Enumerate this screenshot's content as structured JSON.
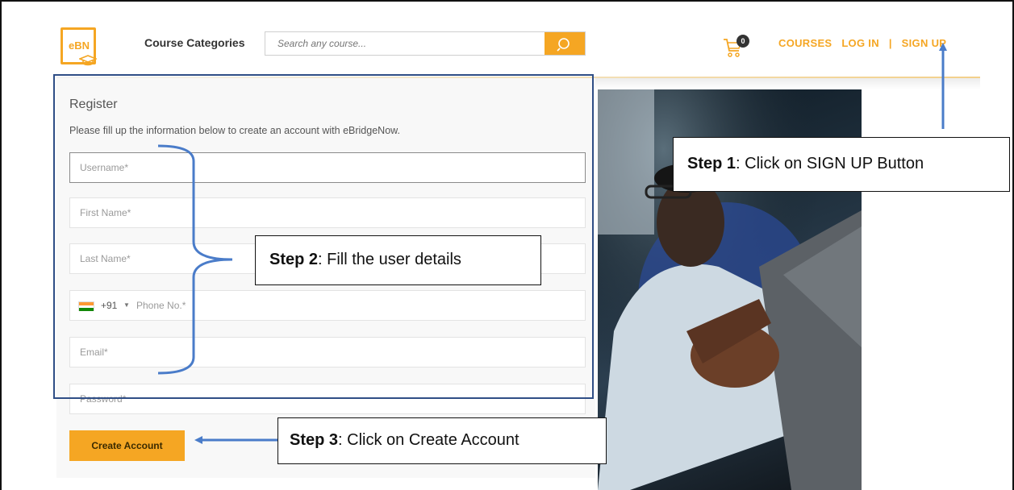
{
  "header": {
    "logo_text": "eBN",
    "course_categories": "Course Categories",
    "search_placeholder": "Search any course...",
    "cart_count": "0",
    "nav": {
      "courses": "COURSES",
      "login": "LOG IN",
      "separator": "|",
      "signup": "SIGN UP"
    },
    "accent_color": "#f5a623"
  },
  "form": {
    "title": "Register",
    "subtitle": "Please fill up the information below to create an account with eBridgeNow.",
    "fields": {
      "username": "Username*",
      "first_name": "First Name*",
      "last_name": "Last Name*",
      "phone_code": "+91",
      "phone": "Phone No.*",
      "email": "Email*",
      "password": "Password*"
    },
    "submit_label": "Create Account"
  },
  "annotations": {
    "step1": {
      "bold": "Step 1",
      "text": ": Click on SIGN UP Button"
    },
    "step2": {
      "bold": "Step 2",
      "text": ": Fill the user details"
    },
    "step3": {
      "bold": "Step 3",
      "text": ": Click on Create Account"
    }
  },
  "icons": {
    "search": "search-icon",
    "cart": "cart-icon",
    "flag": "india-flag-icon",
    "caret": "caret-down-icon",
    "logo": "graduation-cap-icon"
  }
}
